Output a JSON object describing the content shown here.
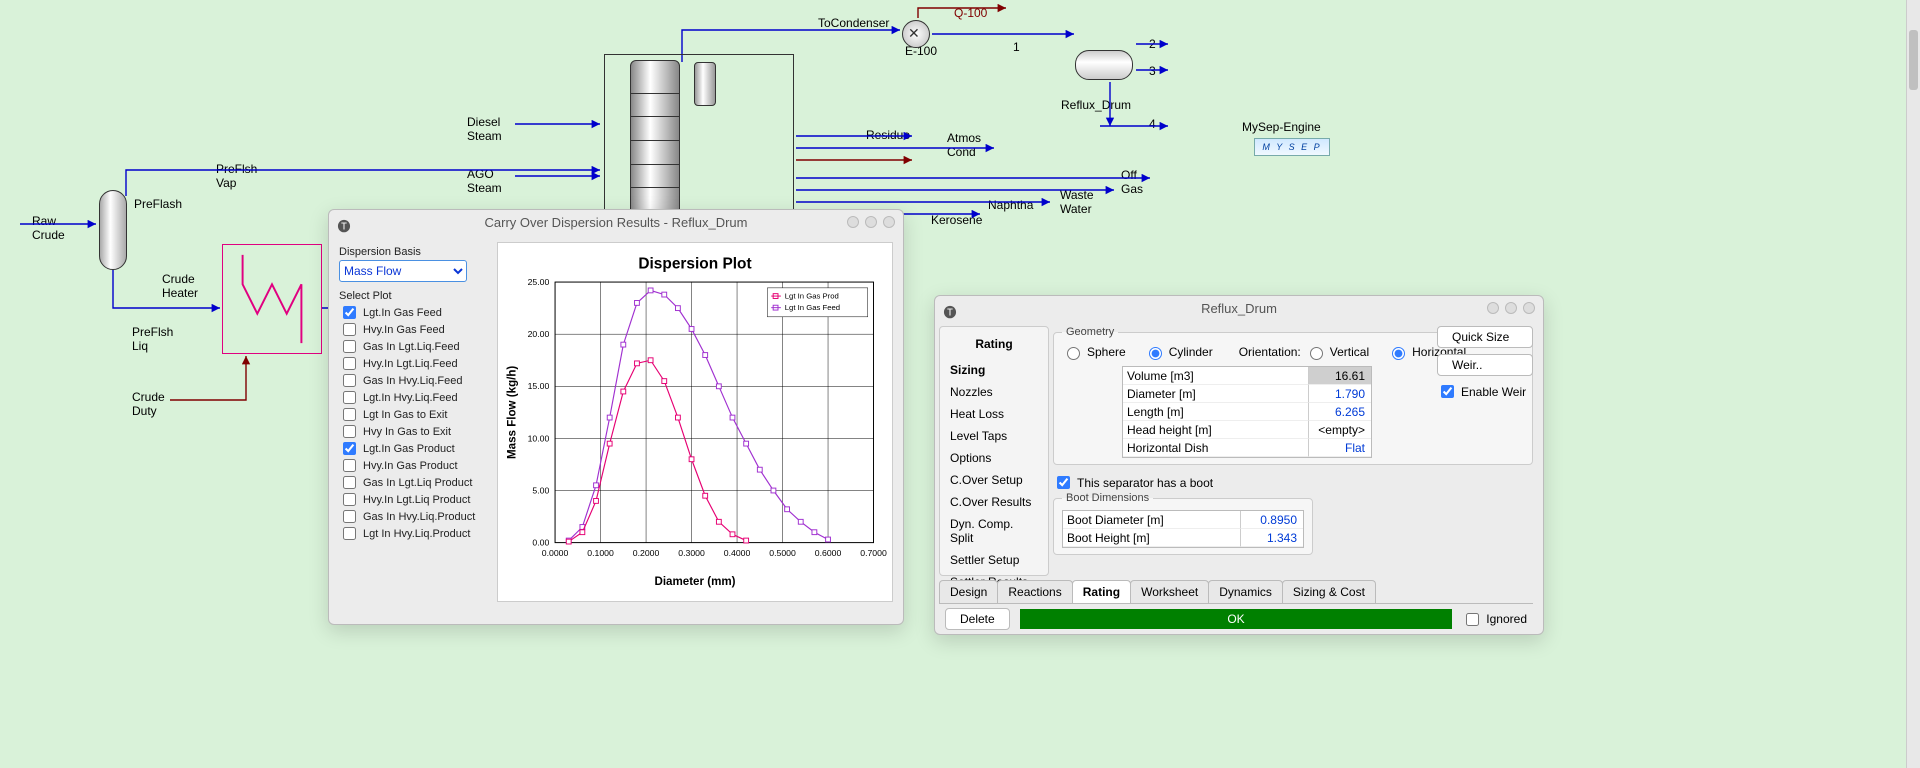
{
  "flowsheet": {
    "labels": {
      "raw_crude": "Raw\nCrude",
      "preflash": "PreFlash",
      "preflash_vap": "PreFlsh\nVap",
      "preflash_liq": "PreFlsh\nLiq",
      "crude_heater": "Crude\nHeater",
      "crude_duty": "Crude\nDuty",
      "diesel_steam": "Diesel\nSteam",
      "ago_steam": "AGO\nSteam",
      "to_condenser": "ToCondenser",
      "e100": "E-100",
      "q100": "Q-100",
      "one": "1",
      "two": "2",
      "three": "3",
      "four": "4",
      "reflux_drum": "Reflux_Drum",
      "mysep_engine": "MySep-Engine",
      "mysep": "M Y S E P",
      "residue": "Residue",
      "atmos_cond": "Atmos\nCond",
      "kerosene": "Kerosene",
      "naphtha": "Naphtha",
      "waste_water": "Waste\nWater",
      "off_gas": "Off\nGas"
    }
  },
  "dispersion_dialog": {
    "title": "Carry Over Dispersion Results - Reflux_Drum",
    "dispersion_basis_label": "Dispersion Basis",
    "dispersion_basis_value": "Mass Flow",
    "select_plot_label": "Select Plot",
    "plot_options": [
      {
        "label": "Lgt.In Gas Feed",
        "checked": true
      },
      {
        "label": "Hvy.In Gas Feed",
        "checked": false
      },
      {
        "label": "Gas In Lgt.Liq.Feed",
        "checked": false
      },
      {
        "label": "Hvy.In Lgt.Liq.Feed",
        "checked": false
      },
      {
        "label": "Gas In Hvy.Liq.Feed",
        "checked": false
      },
      {
        "label": "Lgt.In Hvy.Liq.Feed",
        "checked": false
      },
      {
        "label": "Lgt In Gas to Exit",
        "checked": false
      },
      {
        "label": "Hvy In Gas to Exit",
        "checked": false
      },
      {
        "label": "Lgt.In Gas Product",
        "checked": true
      },
      {
        "label": "Hvy.In Gas Product",
        "checked": false
      },
      {
        "label": "Gas In Lgt.Liq Product",
        "checked": false
      },
      {
        "label": "Hvy.In Lgt.Liq Product",
        "checked": false
      },
      {
        "label": "Gas In Hvy.Liq.Product",
        "checked": false
      },
      {
        "label": "Lgt In Hvy.Liq.Product",
        "checked": false
      }
    ],
    "legend": {
      "prod": "Lgt In Gas Prod",
      "feed": "Lgt In Gas Feed"
    }
  },
  "chart_data": {
    "type": "line",
    "title": "Dispersion Plot",
    "xlabel": "Diameter (mm)",
    "ylabel": "Mass Flow (kg/h)",
    "xlim": [
      0.0,
      0.7
    ],
    "ylim": [
      0.0,
      25.0
    ],
    "xticks": [
      0.0,
      0.1,
      0.2,
      0.3,
      0.4,
      0.5,
      0.6,
      0.7
    ],
    "yticks": [
      0.0,
      5.0,
      10.0,
      15.0,
      20.0,
      25.0
    ],
    "series": [
      {
        "name": "Lgt In Gas Feed",
        "color": "#a030d0",
        "marker": "square",
        "x": [
          0.03,
          0.06,
          0.09,
          0.12,
          0.15,
          0.18,
          0.21,
          0.24,
          0.27,
          0.3,
          0.33,
          0.36,
          0.39,
          0.42,
          0.45,
          0.48,
          0.51,
          0.54,
          0.57,
          0.6
        ],
        "y": [
          0.2,
          1.5,
          5.5,
          12.0,
          19.0,
          23.0,
          24.2,
          23.8,
          22.5,
          20.5,
          18.0,
          15.0,
          12.0,
          9.5,
          7.0,
          5.0,
          3.2,
          2.0,
          1.0,
          0.3
        ]
      },
      {
        "name": "Lgt In Gas Prod",
        "color": "#e60073",
        "marker": "square",
        "x": [
          0.03,
          0.06,
          0.09,
          0.12,
          0.15,
          0.18,
          0.21,
          0.24,
          0.27,
          0.3,
          0.33,
          0.36,
          0.39,
          0.42
        ],
        "y": [
          0.1,
          1.0,
          4.0,
          9.5,
          14.5,
          17.2,
          17.5,
          15.5,
          12.0,
          8.0,
          4.5,
          2.0,
          0.8,
          0.2
        ]
      }
    ]
  },
  "reflux_dialog": {
    "title": "Reflux_Drum",
    "nav_header": "Rating",
    "nav_items": [
      "Sizing",
      "Nozzles",
      "Heat Loss",
      "Level Taps",
      "Options",
      "C.Over Setup",
      "C.Over Results",
      "Dyn. Comp. Split",
      "Settler Setup",
      "Settler Results"
    ],
    "nav_selected": "Sizing",
    "geometry": {
      "legend": "Geometry",
      "shape_sphere": "Sphere",
      "shape_cylinder": "Cylinder",
      "orient_label": "Orientation:",
      "orient_vertical": "Vertical",
      "orient_horizontal": "Horizontal",
      "rows": [
        {
          "k": "Volume [m3]",
          "v": "16.61",
          "cls": "hl"
        },
        {
          "k": "Diameter [m]",
          "v": "1.790",
          "cls": ""
        },
        {
          "k": "Length [m]",
          "v": "6.265",
          "cls": ""
        },
        {
          "k": "Head height [m]",
          "v": "<empty>",
          "cls": "black"
        },
        {
          "k": "Horizontal Dish",
          "v": "Flat",
          "cls": ""
        }
      ]
    },
    "has_boot_label": "This separator has a boot",
    "boot_legend": "Boot Dimensions",
    "boot_rows": [
      {
        "k": "Boot Diameter [m]",
        "v": "0.8950"
      },
      {
        "k": "Boot Height [m]",
        "v": "1.343"
      }
    ],
    "buttons": {
      "quick": "Quick Size",
      "weir": "Weir..",
      "enable_weir": "Enable Weir"
    },
    "tabs": [
      "Design",
      "Reactions",
      "Rating",
      "Worksheet",
      "Dynamics",
      "Sizing & Cost"
    ],
    "selected_tab": "Rating",
    "footer": {
      "delete": "Delete",
      "ok": "OK",
      "ignored": "Ignored"
    }
  }
}
